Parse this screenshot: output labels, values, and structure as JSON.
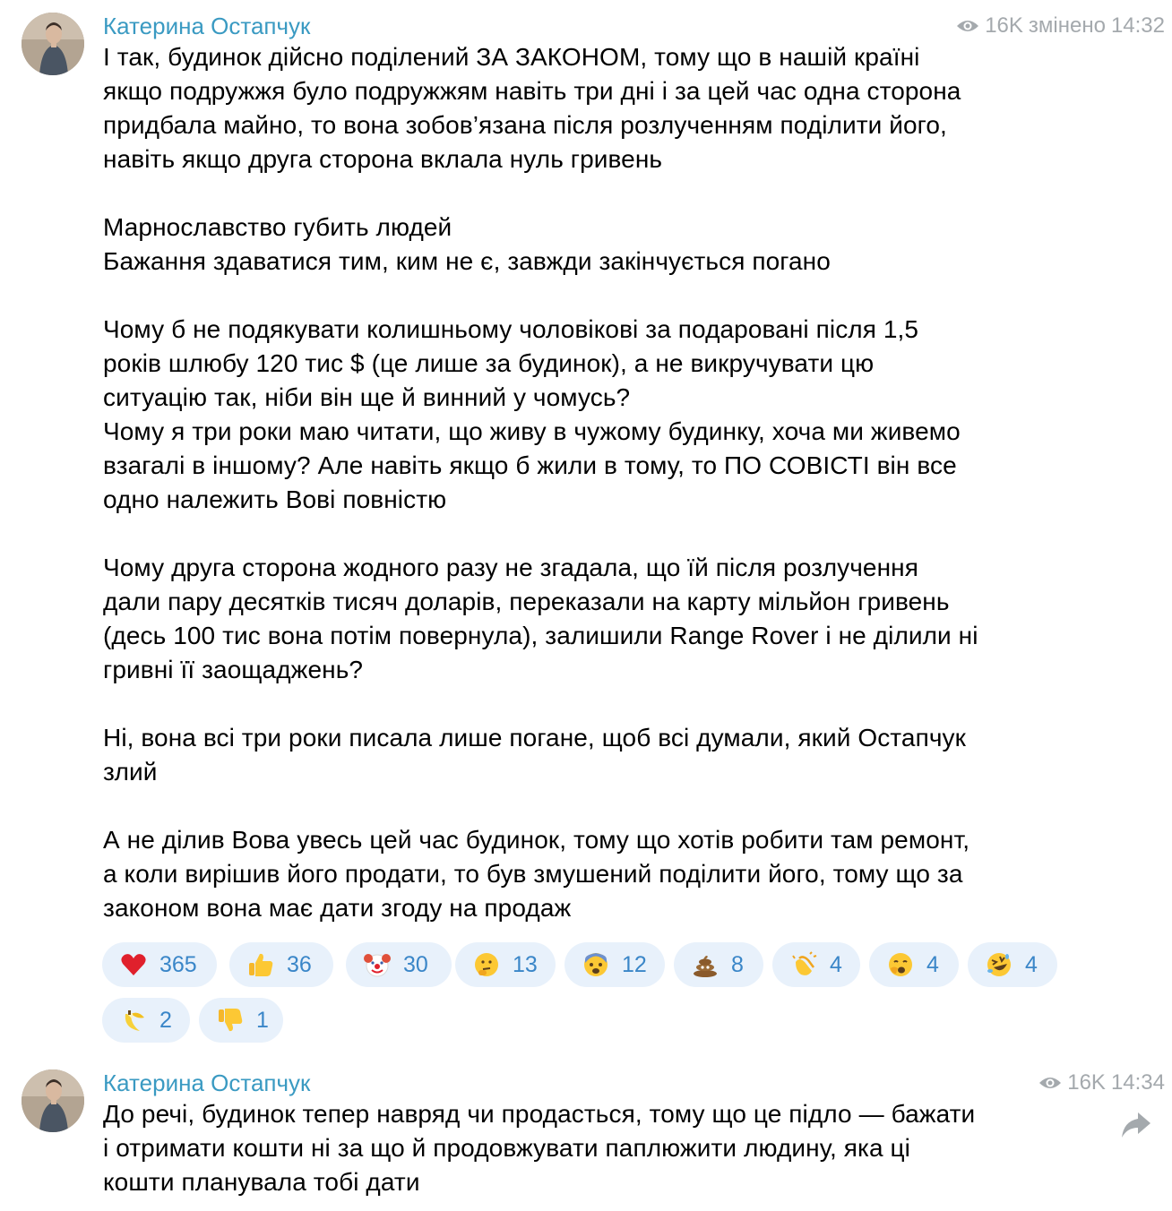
{
  "posts": [
    {
      "author": "Катерина Остапчук",
      "views": "16K",
      "edited": "змінено",
      "time": "14:32",
      "text": "І так, будинок дійсно поділений ЗА ЗАКОНОМ, тому що в нашій країні\nякщо подружжя було подружжям навіть три дні і за цей час одна сторона\nпридбала майно, то вона зобов’язана після розлученням поділити його,\nнавіть якщо друга сторона вклала нуль гривень\n\nМарнославство губить людей\nБажання здаватися тим, ким не є, завжди закінчується погано\n\nЧому б не подякувати колишньому чоловікові за подаровані після 1,5\nроків шлюбу 120 тис $ (це лише за будинок), а не викручувати цю\nситуацію так, ніби він ще й винний у чомусь?\nЧому я три роки маю читати, що живу в чужому будинку, хоча ми живемо\nвзагалі в іншому? Але навіть якщо б жили в тому, то ПО СОВІСТІ він все\nодно належить Вові повністю\n\nЧому друга сторона жодного разу не згадала, що їй після розлучення\nдали пару десятків тисяч доларів, переказали на карту мільйон гривень\n(десь 100 тис вона потім повернула), залишили Range Rover і не ділили ні\nгривні її заощаджень?\n\nНі, вона всі три роки писала лише погане, щоб всі думали, який Остапчук\nзлий\n\nА не ділив Вова увесь цей час будинок, тому що хотів робити там ремонт,\nа коли вирішив його продати, то був змушений поділити його, тому що за\nзаконом вона має дати згоду на продаж",
      "reactions": [
        {
          "icon": "heart-icon",
          "count": "365"
        },
        {
          "icon": "thumbs-up-icon",
          "count": "36"
        },
        {
          "icon": "clown-icon",
          "count": "30"
        },
        {
          "icon": "thinking-face-icon",
          "count": "13"
        },
        {
          "icon": "fearful-face-icon",
          "count": "12"
        },
        {
          "icon": "poop-icon",
          "count": "8"
        },
        {
          "icon": "clapping-hands-icon",
          "count": "4"
        },
        {
          "icon": "yawning-face-icon",
          "count": "4"
        },
        {
          "icon": "rofl-face-icon",
          "count": "4"
        },
        {
          "icon": "banana-icon",
          "count": "2"
        },
        {
          "icon": "thumbs-down-icon",
          "count": "1"
        }
      ]
    },
    {
      "author": "Катерина Остапчук",
      "views": "16K",
      "time": "14:34",
      "text": "До речі, будинок тепер навряд чи продасться, тому що це підло — бажати\nі отримати кошти ні за що й продовжувати паплюжити людину, яка ці\nкошти планувала тобі дати"
    }
  ],
  "colors": {
    "author": "#3a9ac2",
    "meta": "#a4a9ad",
    "reaction_bg": "#e8f1fb",
    "reaction_text": "#3a86c8"
  }
}
